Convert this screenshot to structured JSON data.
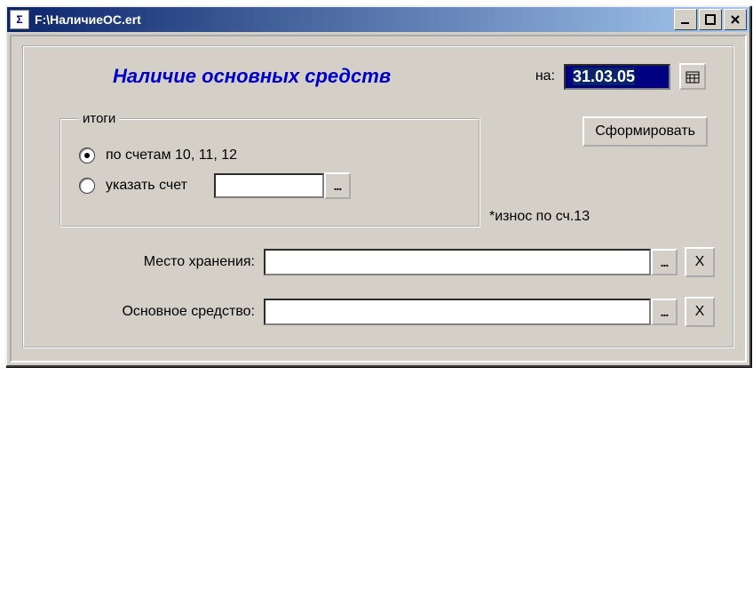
{
  "window": {
    "title": "F:\\НаличиеОС.ert"
  },
  "header": {
    "title": "Наличие основных средств",
    "date_label": "на:",
    "date_value": "31.03.05"
  },
  "group": {
    "legend": "итоги",
    "radio1_label": "по счетам 10, 11, 12",
    "radio2_label": "указать счет",
    "account_value": ""
  },
  "buttons": {
    "generate": "Сформировать"
  },
  "note": "*износ по сч.13",
  "fields": {
    "storage_label": "Место хранения:",
    "storage_value": "",
    "asset_label": "Основное средство:",
    "asset_value": ""
  },
  "ellipsis": "..."
}
